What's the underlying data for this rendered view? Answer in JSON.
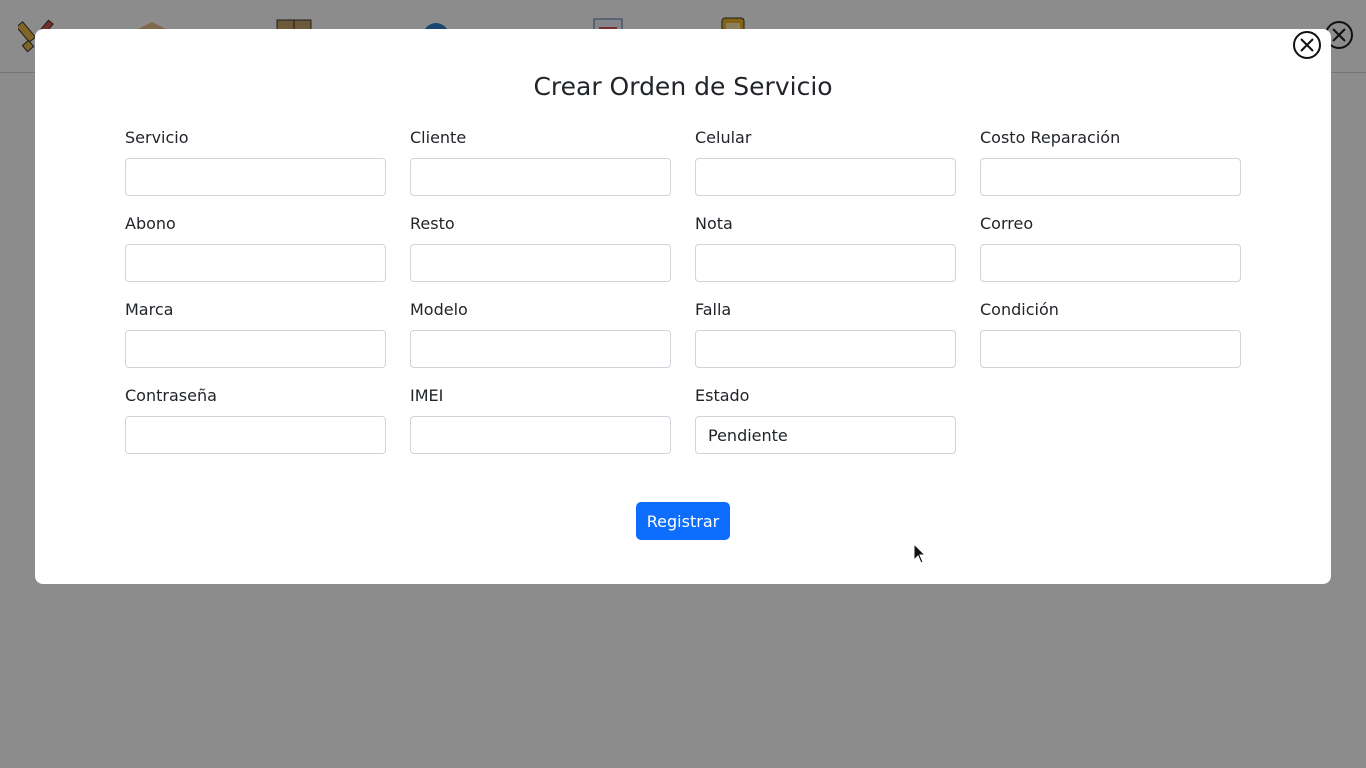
{
  "nav": {
    "items": [
      {
        "icon": "tools-icon"
      },
      {
        "icon": "box-icon"
      },
      {
        "icon": "inventory-icon"
      },
      {
        "icon": "gear-icon"
      },
      {
        "icon": "invoice-icon"
      },
      {
        "icon": "phone-repair-icon"
      }
    ]
  },
  "modal": {
    "title": "Crear Orden de Servicio",
    "fields": [
      {
        "label": "Servicio",
        "value": ""
      },
      {
        "label": "Cliente",
        "value": ""
      },
      {
        "label": "Celular",
        "value": ""
      },
      {
        "label": "Costo Reparación",
        "value": ""
      },
      {
        "label": "Abono",
        "value": ""
      },
      {
        "label": "Resto",
        "value": ""
      },
      {
        "label": "Nota",
        "value": ""
      },
      {
        "label": "Correo",
        "value": ""
      },
      {
        "label": "Marca",
        "value": ""
      },
      {
        "label": "Modelo",
        "value": ""
      },
      {
        "label": "Falla",
        "value": ""
      },
      {
        "label": "Condición",
        "value": ""
      },
      {
        "label": "Contraseña",
        "value": ""
      },
      {
        "label": "IMEI",
        "value": ""
      },
      {
        "label": "Estado",
        "value": "Pendiente"
      }
    ],
    "submit_label": "Registrar"
  },
  "colors": {
    "primary": "#0d6efd",
    "overlay": "#000000"
  }
}
